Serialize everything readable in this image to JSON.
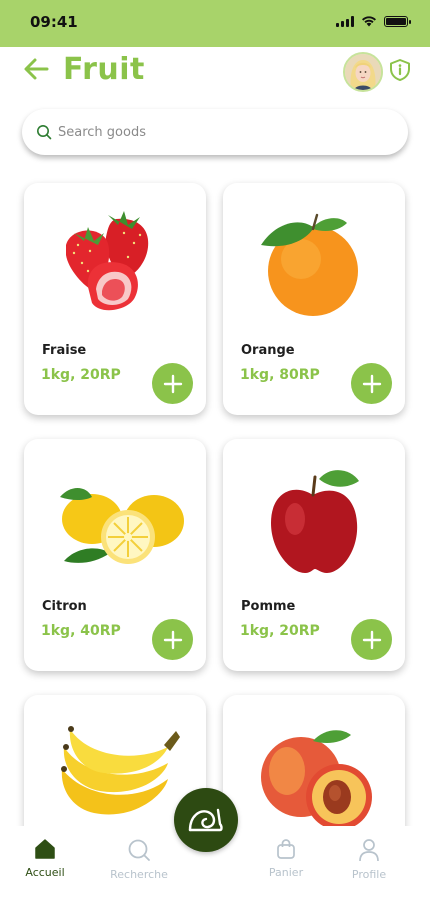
{
  "status_bar": {
    "time": "09:41"
  },
  "header": {
    "title": "Fruit",
    "back_icon": "arrow-left-icon",
    "shield_icon": "shield-info-icon"
  },
  "search": {
    "placeholder": "Search goods",
    "value": ""
  },
  "products": [
    {
      "name": "Fraise",
      "price": "1kg, 20RP"
    },
    {
      "name": "Orange",
      "price": "1kg, 80RP"
    },
    {
      "name": "Citron",
      "price": "1kg, 40RP"
    },
    {
      "name": "Pomme",
      "price": "1kg, 20RP"
    },
    {
      "name": "",
      "price": ""
    },
    {
      "name": "",
      "price": ""
    }
  ],
  "bottom_nav": {
    "items": [
      {
        "label": "Accueil",
        "icon": "home-icon"
      },
      {
        "label": "Recherche",
        "icon": "search-icon"
      },
      {
        "label": "Panier",
        "icon": "bag-icon"
      },
      {
        "label": "Profile",
        "icon": "user-icon"
      }
    ],
    "fab_icon": "snail-logo-icon"
  },
  "colors": {
    "accent": "#8bc34a",
    "status_bar": "#a8d36a",
    "dark_green": "#2d4a12",
    "nav_inactive": "#b8c3cc"
  }
}
